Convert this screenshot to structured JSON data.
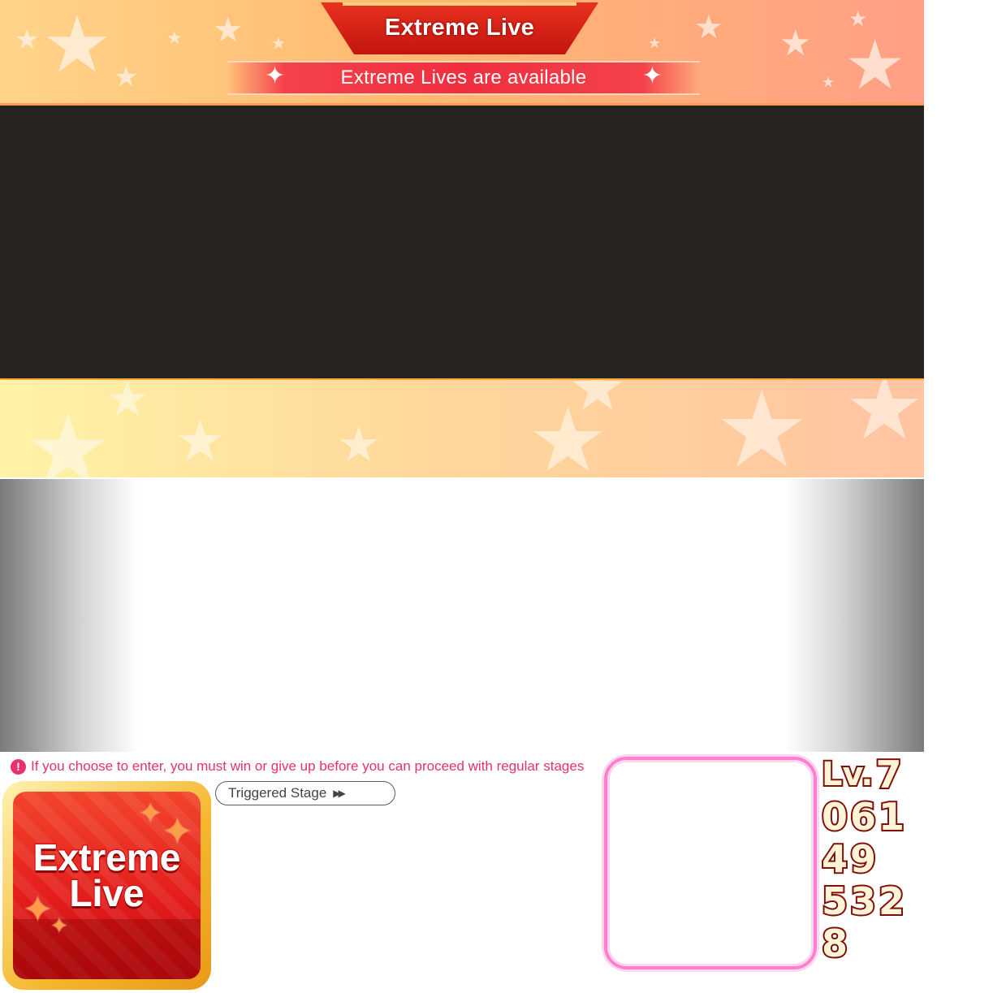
{
  "header": {
    "title": "Extreme Live",
    "subtitle": "Extreme Lives are available"
  },
  "notice": {
    "icon": "exclamation-icon",
    "icon_glyph": "!",
    "text": "If you choose to enter, you must win or give up before you can proceed with regular stages"
  },
  "extreme_icon": {
    "line1": "Extreme",
    "line2": "Live"
  },
  "triggered_stage": {
    "label": "Triggered Stage",
    "icon": "double-chevron-right-icon",
    "icon_glyph": "▶▶"
  },
  "level_digits": {
    "row1": [
      "Lv.",
      "7"
    ],
    "row2": [
      "0",
      "6",
      "1"
    ],
    "row3": [
      "4",
      "9"
    ],
    "row4": [
      "5",
      "3",
      "2"
    ],
    "row5": [
      "8"
    ]
  },
  "colors": {
    "accent_red": "#e21b1b",
    "notice_pink": "#e8306a",
    "frame_pink": "#ff7fcf",
    "gold": "#f5b62c"
  }
}
